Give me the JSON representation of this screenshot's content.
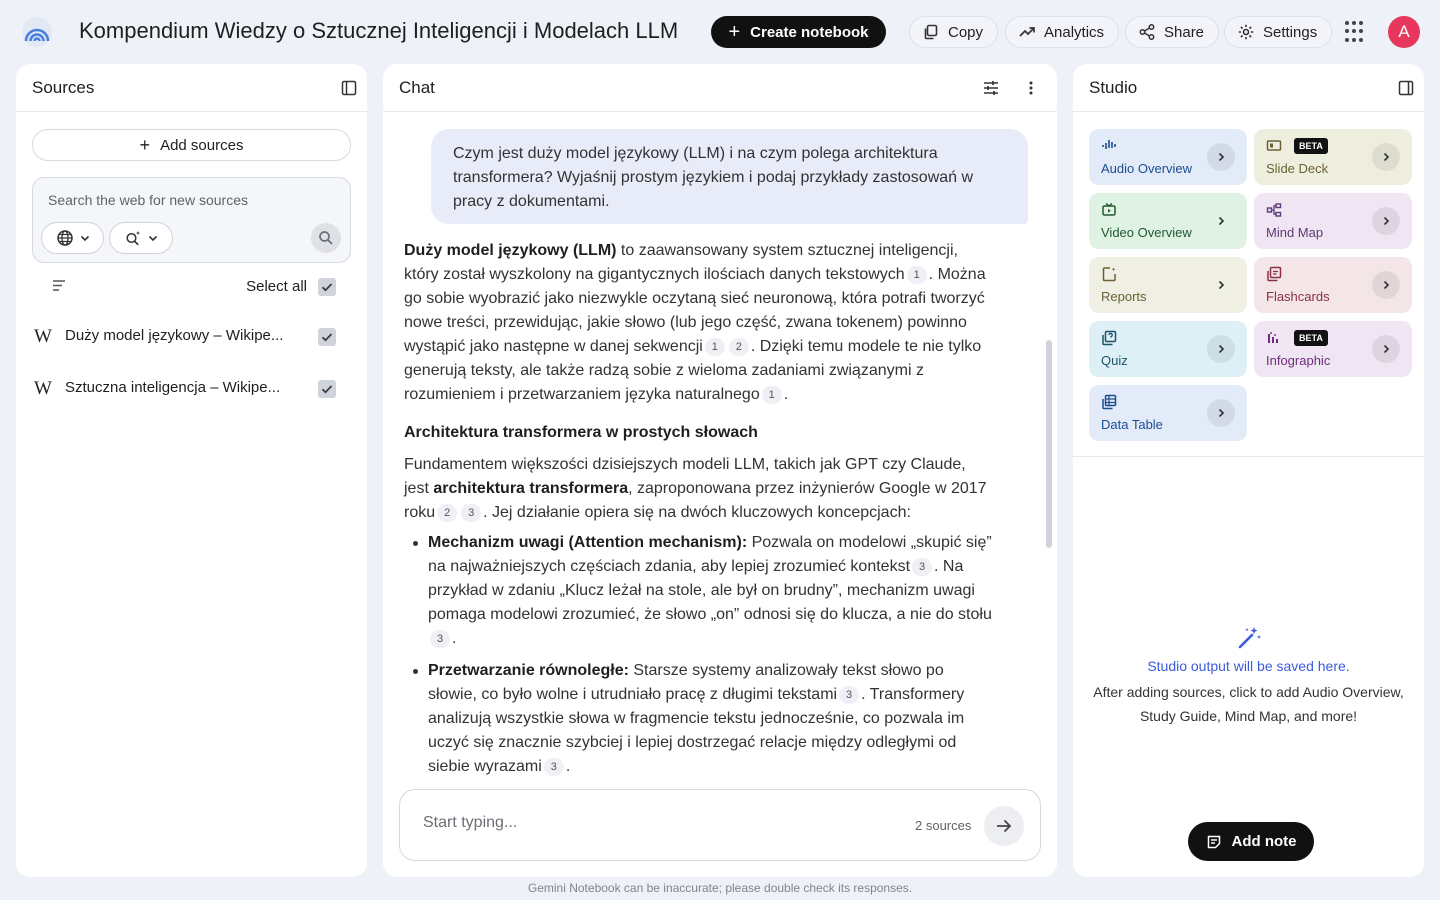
{
  "header": {
    "title": "Kompendium Wiedzy o Sztucznej Inteligencji i Modelach LLM",
    "create_label": "Create notebook",
    "copy_label": "Copy",
    "analytics_label": "Analytics",
    "share_label": "Share",
    "settings_label": "Settings",
    "avatar_initial": "A",
    "avatar_color": "#e8375c"
  },
  "sources": {
    "title": "Sources",
    "add_label": "Add sources",
    "search_placeholder": "Search the web for new sources",
    "select_all_label": "Select all",
    "items": [
      {
        "icon": "wikipedia-icon",
        "name": "Duży model językowy – Wikipe...",
        "checked": true
      },
      {
        "icon": "wikipedia-icon",
        "name": "Sztuczna inteligencja – Wikipe...",
        "checked": true
      }
    ]
  },
  "chat": {
    "title": "Chat",
    "user_message": "Czym jest duży model językowy (LLM) i na czym polega architektura transformera? Wyjaśnij prostym językiem i podaj przykłady zastosowań w pracy z dokumentami.",
    "answer": {
      "p1": {
        "bold": "Duży model językowy (LLM)",
        "t1": " to zaawansowany system sztucznej inteligencji, który został wyszkolony na gigantycznych ilościach danych tekstowych",
        "c1": "1",
        "t2": ". Można go sobie wyobrazić jako niezwykle oczytaną sieć neuronową, która potrafi tworzyć nowe treści, przewidując, jakie słowo (lub jego część, zwana tokenem) powinno wystąpić jako następne w danej sekwencji",
        "c2": "1",
        "c3": "2",
        "t3": ". Dzięki temu modele te nie tylko generują teksty, ale także radzą sobie z wieloma zadaniami związanymi z rozumieniem i przetwarzaniem języka naturalnego",
        "c4": "1",
        "t4": "."
      },
      "heading": "Architektura transformera w prostych słowach",
      "p2": {
        "t1": "Fundamentem większości dzisiejszych modeli LLM, takich jak GPT czy Claude, jest ",
        "bold": "architektura transformera",
        "t2": ", zaproponowana przez inżynierów Google w 2017 roku",
        "c1": "2",
        "c2": "3",
        "t3": ". Jej działanie opiera się na dwóch kluczowych koncepcjach:"
      },
      "bullets": [
        {
          "bold": "Mechanizm uwagi (Attention mechanism):",
          "t1": " Pozwala on modelowi „skupić się” na najważniejszych częściach zdania, aby lepiej zrozumieć kontekst",
          "c1": "3",
          "t2": ". Na przykład w zdaniu „Klucz leżał na stole, ale był on brudny”, mechanizm uwagi pomaga modelowi zrozumieć, że słowo „on” odnosi się do klucza, a nie do stołu",
          "c2": "3",
          "t3": "."
        },
        {
          "bold": "Przetwarzanie równoległe:",
          "t1": " Starsze systemy analizowały tekst słowo po słowie, co było wolne i utrudniało pracę z długimi tekstami",
          "c1": "3",
          "t2": ". Transformery analizują wszystkie słowa w fragmencie tekstu jednocześnie, co pozwala im uczyć się znacznie szybciej i lepiej dostrzegać relacje między odległymi od siebie wyrazami",
          "c2": "3",
          "t3": "."
        }
      ]
    },
    "input_placeholder": "Start typing...",
    "source_count": "2 sources"
  },
  "studio": {
    "title": "Studio",
    "beta_label": "BETA",
    "tiles": [
      {
        "label": "Audio Overview",
        "icon": "audio-waveform-icon",
        "bg": "#e3ebf9",
        "fg": "#1d4d8f"
      },
      {
        "label": "Slide Deck",
        "icon": "slides-icon",
        "bg": "#eeeedf",
        "fg": "#6b6233"
      },
      {
        "label": "Video Overview",
        "icon": "video-icon",
        "bg": "#dff2e4",
        "fg": "#1f5a31"
      },
      {
        "label": "Mind Map",
        "icon": "mind-map-icon",
        "bg": "#efe5f3",
        "fg": "#5d3a78"
      },
      {
        "label": "Reports",
        "icon": "reports-icon",
        "bg": "#efefe3",
        "fg": "#6b6233"
      },
      {
        "label": "Flashcards",
        "icon": "flashcards-icon",
        "bg": "#f4e6e8",
        "fg": "#8a2f45"
      },
      {
        "label": "Quiz",
        "icon": "quiz-icon",
        "bg": "#dcf0f6",
        "fg": "#1e5266"
      },
      {
        "label": "Infographic",
        "icon": "infographic-icon",
        "bg": "#efe5f3",
        "fg": "#6d2d7a"
      },
      {
        "label": "Data Table",
        "icon": "data-table-icon",
        "bg": "#e3ebf9",
        "fg": "#1d4d8f"
      }
    ],
    "empty_title": "Studio output will be saved here.",
    "empty_desc": "After adding sources, click to add Audio Overview, Study Guide, Mind Map, and more!",
    "add_note_label": "Add note"
  },
  "footer": "Gemini Notebook can be inaccurate; please double check its responses."
}
